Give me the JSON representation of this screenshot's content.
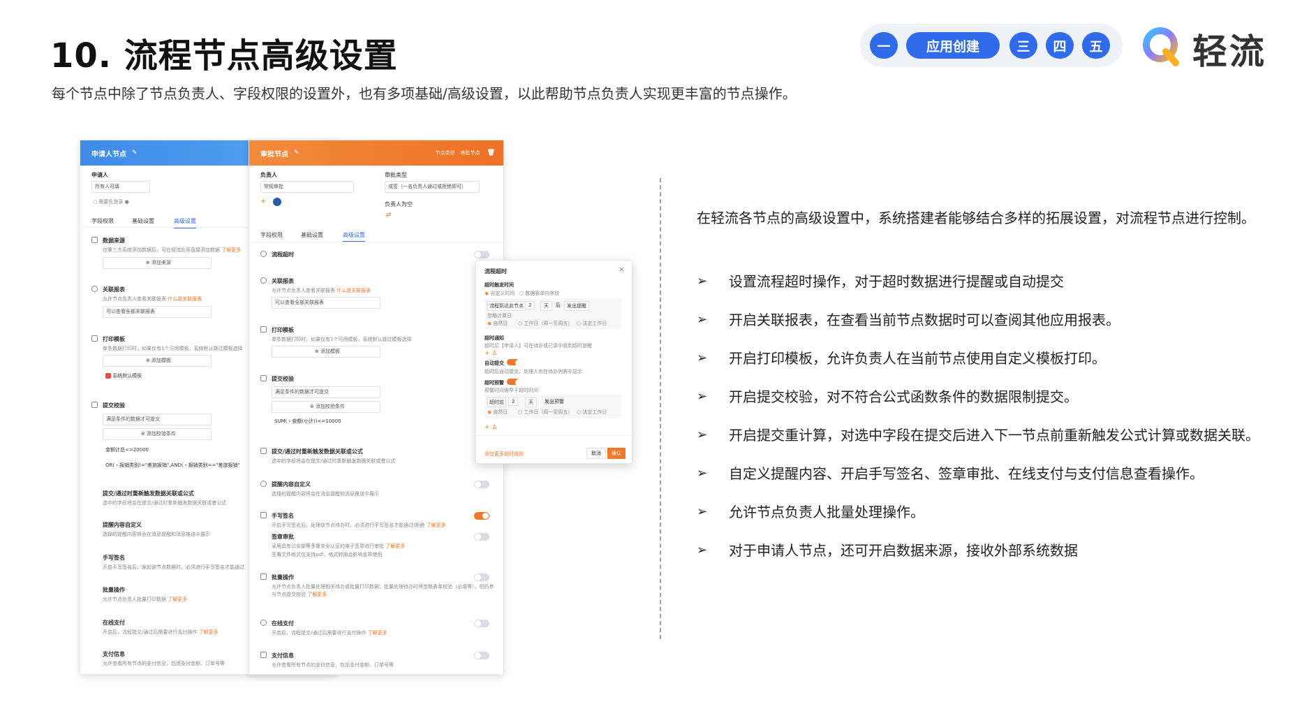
{
  "header": {
    "title": "10. 流程节点高级设置",
    "subtitle": "每个节点中除了节点负责人、字段权限的设置外，也有多项基础/高级设置，以此帮助节点负责人实现更丰富的节点操作。"
  },
  "stepnav": {
    "steps": [
      "一",
      "应用创建",
      "三",
      "四",
      "五"
    ],
    "accent": "#2f6bea"
  },
  "logo": {
    "text": "轻流"
  },
  "left_panel": {
    "header": "申请人节点",
    "header_color": "#3f8ae8",
    "applicant_label": "申请人",
    "applicant_value": "所有人可填",
    "login_required": "需要先登录",
    "tabs": [
      "字段权限",
      "基础设置",
      "高级设置"
    ],
    "sections": [
      {
        "title": "数据来源",
        "desc": "在第三方系统添加数据后，可在轻流应用直接添加数据",
        "link": "了解更多",
        "action": "添加来源"
      },
      {
        "title": "关联报表",
        "desc": "允许节点负责人查看关联报表",
        "link": "什么是关联报表",
        "action": "可以查看全部关联报表"
      },
      {
        "title": "打印模板",
        "desc": "单条数据打印时，如果仅有1个可用模板，系统默认跳过模板选择",
        "action": "添加模板",
        "extra": "系统默认模板"
      },
      {
        "title": "提交校验",
        "action": "满足条件的数据才可提交",
        "action2": "添加校验条件",
        "rule1": "金额计总<=20000",
        "rule2": "OR(・报销类别!=\"差旅报销\",AND(・报销类别==\"差旅报销\""
      },
      {
        "title": "提交/通过时重新触发数据关联或公式",
        "desc": "选中的字段将会在提交/通过时重新触发数据关联或者公式"
      },
      {
        "title": "提醒内容自定义",
        "desc": "选择的提醒内容将会在消息提醒和消息推送中展示"
      },
      {
        "title": "手写签名",
        "desc": "开启手写签名后，发起该节点数据时，必须进行手写签名才能通过"
      },
      {
        "title": "批量操作",
        "desc": "允许节点负责人批量打印数据",
        "link": "了解更多"
      },
      {
        "title": "在线支付",
        "desc": "开启后，流程提交/通过后需要进行支付操作",
        "link": "了解更多"
      },
      {
        "title": "支付信息",
        "desc": "允许查看所有节点的支付信息，包括支付金额、订单号等"
      }
    ]
  },
  "right_panel": {
    "header": "审批节点",
    "header_color": "#f0782a",
    "header_right": [
      "节点类型",
      "审批节点"
    ],
    "owner_label": "负责人",
    "owner_value": "常规审批",
    "approve_type_label": "审批类型",
    "approve_type_value": "或签（一名负责人通过或拒绝即可）",
    "owner_empty_label": "负责人为空",
    "tabs": [
      "字段权限",
      "基础设置",
      "高级设置"
    ],
    "sections": [
      {
        "title": "流程超时",
        "on": false
      },
      {
        "title": "关联报表",
        "desc": "允许节点负责人查看关联报表",
        "link": "什么是关联报表",
        "action": "可以查看全部关联报表"
      },
      {
        "title": "打印模板",
        "desc": "单条数据打印时，如果仅有1个可用模板，系统默认跳过模板选择",
        "action": "添加模板"
      },
      {
        "title": "提交校验",
        "action": "满足条件的数据才可提交",
        "action2": "添加校验条件",
        "rule": "SUM(・金额(小计))<=10000"
      },
      {
        "title": "提交/通过时重新触发数据关联或公式",
        "desc": "选中的字段将会在提交/通过时重新触发数据关联或者公式"
      },
      {
        "title": "提醒内容自定义",
        "desc": "选择的提醒内容将会在消息提醒和消息推送中展示",
        "on": false
      },
      {
        "title": "手写签名",
        "desc": "开启手写签名后，处理该节点待办时，必须进行手写签名才能通过/拒绝",
        "link": "了解更多",
        "on": true
      },
      {
        "title": "签章审批",
        "desc": "采用具有公安部等多重安全认证的电子签章进行审批",
        "link": "了解更多",
        "desc2": "签署文件格式仅支持pdf，格式转换会影响盖章使用",
        "on": false
      },
      {
        "title": "批量操作",
        "desc": "允许节点负责人批量处理相关待办或批量打印数据；批量处理待办时将忽略表单校验（必填等），但仍参与节点提交校验",
        "link": "了解更多",
        "on": false
      },
      {
        "title": "在线支付",
        "desc": "开启后，流程提交/通过后需要进行支付操作",
        "link": "了解更多",
        "on": false
      },
      {
        "title": "支付信息",
        "desc": "允许查看所有节点的支付信息，包括支付金额、订单号等",
        "on": false
      }
    ]
  },
  "modal": {
    "title": "流程超时",
    "close": "×",
    "r1_label": "超时触发时间",
    "r1_opt1": "自定义时间",
    "r1_opt2": "数据表单内字段",
    "row_a": "流程到达此节点",
    "row_b": "2",
    "row_c": "天",
    "row_d": "后",
    "row_e": "发出提醒",
    "skip_label": "忽略计算日",
    "skip_opts": [
      "自然日",
      "工作日（周一至周五）",
      "法定工作日"
    ],
    "notify_title": "超时通知",
    "notify_desc": "超时后【申请人】可在待办或已读中收到超时提醒",
    "auto_title": "自动提交",
    "auto_desc": "超时后自动提交，处理人也在待办列表中显示",
    "warn_title": "超时预警",
    "warn_desc": "预警时间需早于超时时间",
    "warn_row": [
      "超时前",
      "2",
      "天",
      "发出预警"
    ],
    "add_link": "添加更多超时规则",
    "cancel": "取消",
    "confirm": "确认"
  },
  "right_text": {
    "intro": "在轻流各节点的高级设置中，系统搭建者能够结合多样的拓展设置，对流程节点进行控制。",
    "bullets": [
      "设置流程超时操作，对于超时数据进行提醒或自动提交",
      "开启关联报表，在查看当前节点数据时可以查阅其他应用报表。",
      "开启打印模板，允许负责人在当前节点使用自定义模板打印。",
      "开启提交校验，对不符合公式函数条件的数据限制提交。",
      "开启提交重计算，对选中字段在提交后进入下一节点前重新触发公式计算或数据关联。",
      "自定义提醒内容、开启手写签名、签章审批、在线支付与支付信息查看操作。",
      "允许节点负责人批量处理操作。",
      "对于申请人节点，还可开启数据来源，接收外部系统数据"
    ],
    "bullet_mark": "➢"
  }
}
